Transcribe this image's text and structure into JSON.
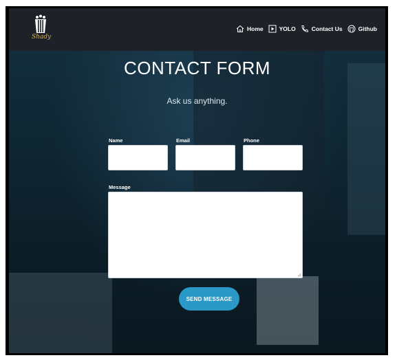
{
  "brand": {
    "logo_text": "Shady"
  },
  "nav": {
    "items": [
      {
        "label": "Home",
        "icon": "home-icon"
      },
      {
        "label": "YOLO",
        "icon": "play-icon"
      },
      {
        "label": "Contact Us",
        "icon": "phone-icon"
      },
      {
        "label": "Github",
        "icon": "github-icon"
      }
    ]
  },
  "form": {
    "title": "CONTACT FORM",
    "subtitle": "Ask us anything.",
    "fields": {
      "name_label": "Name",
      "email_label": "Email",
      "phone_label": "Phone",
      "message_label": "Message",
      "name_value": "",
      "email_value": "",
      "phone_value": "",
      "message_value": ""
    },
    "submit_label": "SEND MESSAGE"
  },
  "colors": {
    "navbar": "#1e2128",
    "accent": "#2a99c7",
    "logo": "#d8b24a",
    "background": "#0f2633"
  }
}
